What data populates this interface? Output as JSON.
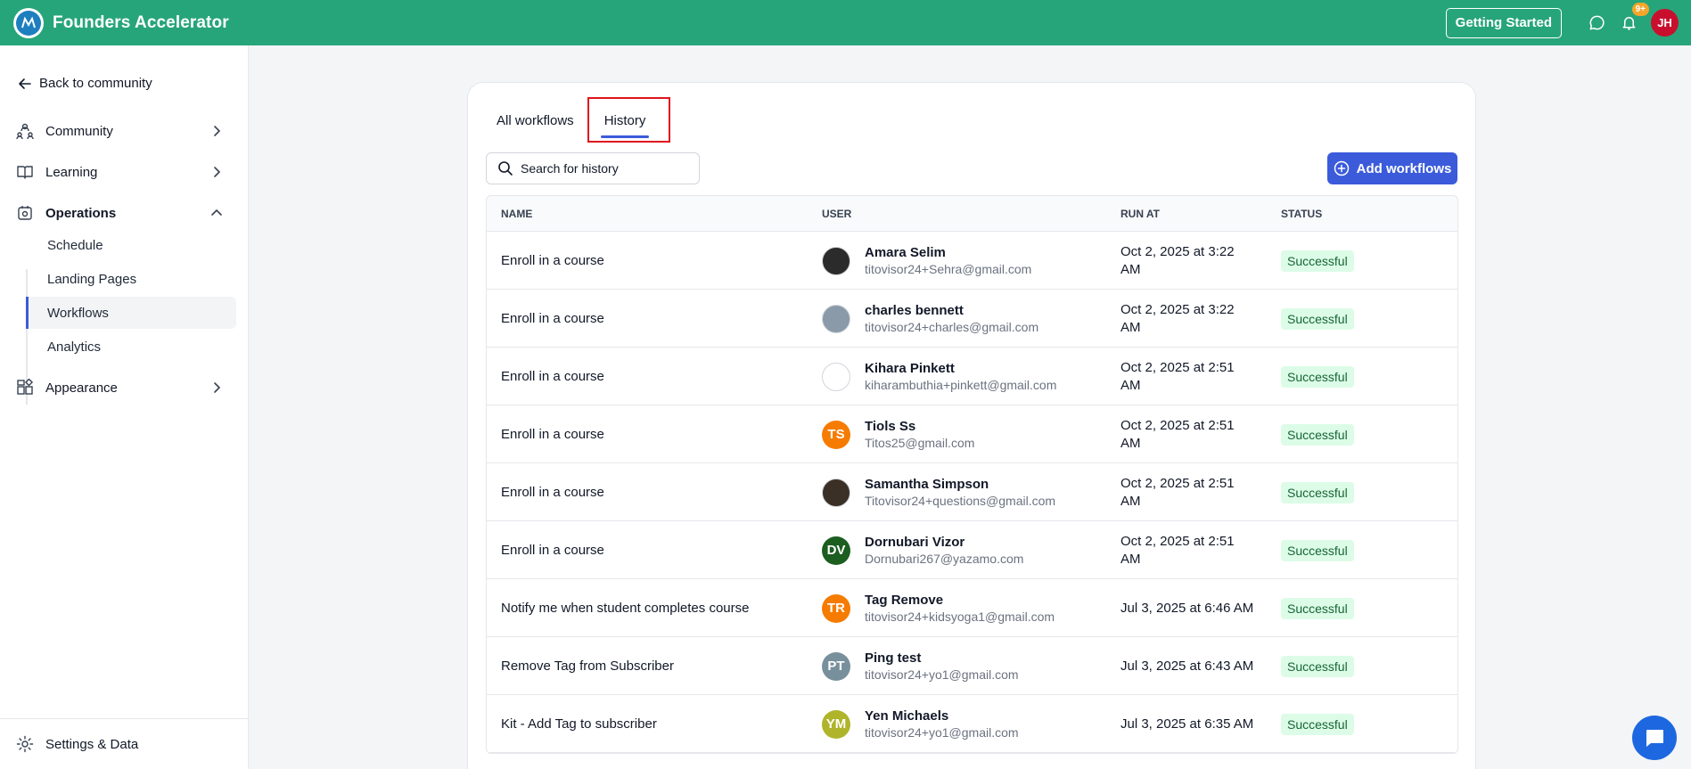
{
  "header": {
    "brand": "Founders Accelerator",
    "getting_started": "Getting Started",
    "notification_count": "9+",
    "user_initials": "JH",
    "colors": {
      "bar": "#27a57a",
      "avatar": "#c8102e"
    }
  },
  "sidebar": {
    "back_label": "Back to community",
    "items": [
      {
        "label": "Community",
        "icon": "community-icon"
      },
      {
        "label": "Learning",
        "icon": "book-icon"
      },
      {
        "label": "Operations",
        "icon": "operations-icon"
      },
      {
        "label": "Appearance",
        "icon": "appearance-icon"
      }
    ],
    "sub_items": [
      {
        "label": "Schedule"
      },
      {
        "label": "Landing Pages"
      },
      {
        "label": "Workflows"
      },
      {
        "label": "Analytics"
      }
    ],
    "footer_label": "Settings & Data"
  },
  "main": {
    "tabs": [
      {
        "label": "All workflows"
      },
      {
        "label": "History"
      }
    ],
    "search_placeholder": "Search for history",
    "add_button": "Add workflows",
    "table": {
      "headers": [
        "NAME",
        "USER",
        "RUN AT",
        "STATUS"
      ],
      "rows": [
        {
          "name": "Enroll in a course",
          "user": "Amara Selim",
          "email": "titovisor24+Sehra@gmail.com",
          "run_at": "Oct 2, 2025 at 3:22 AM",
          "status": "Successful",
          "initials": "",
          "avatar_color": "#2b2b2b"
        },
        {
          "name": "Enroll in a course",
          "user": "charles bennett",
          "email": "titovisor24+charles@gmail.com",
          "run_at": "Oct 2, 2025 at 3:22 AM",
          "status": "Successful",
          "initials": "",
          "avatar_color": "#8a9aa8"
        },
        {
          "name": "Enroll in a course",
          "user": "Kihara Pinkett",
          "email": "kiharambuthia+pinkett@gmail.com",
          "run_at": "Oct 2, 2025 at 2:51 AM",
          "status": "Successful",
          "initials": "",
          "avatar_color": "#ffffff"
        },
        {
          "name": "Enroll in a course",
          "user": "Tiols Ss",
          "email": "Titos25@gmail.com",
          "run_at": "Oct 2, 2025 at 2:51 AM",
          "status": "Successful",
          "initials": "TS",
          "avatar_color": "#f57c00"
        },
        {
          "name": "Enroll in a course",
          "user": "Samantha Simpson",
          "email": "Titovisor24+questions@gmail.com",
          "run_at": "Oct 2, 2025 at 2:51 AM",
          "status": "Successful",
          "initials": "",
          "avatar_color": "#3b3026"
        },
        {
          "name": "Enroll in a course",
          "user": "Dornubari Vizor",
          "email": "Dornubari267@yazamo.com",
          "run_at": "Oct 2, 2025 at 2:51 AM",
          "status": "Successful",
          "initials": "DV",
          "avatar_color": "#1b5e20"
        },
        {
          "name": "Notify me when student completes course",
          "user": "Tag Remove",
          "email": "titovisor24+kidsyoga1@gmail.com",
          "run_at": "Jul 3, 2025 at 6:46 AM",
          "status": "Successful",
          "initials": "TR",
          "avatar_color": "#f57c00"
        },
        {
          "name": "Remove Tag from Subscriber",
          "user": "Ping test",
          "email": "titovisor24+yo1@gmail.com",
          "run_at": "Jul 3, 2025 at 6:43 AM",
          "status": "Successful",
          "initials": "PT",
          "avatar_color": "#78909c"
        },
        {
          "name": "Kit - Add Tag to subscriber",
          "user": "Yen Michaels",
          "email": "titovisor24+yo1@gmail.com",
          "run_at": "Jul 3, 2025 at 6:35 AM",
          "status": "Successful",
          "initials": "YM",
          "avatar_color": "#afb42b"
        }
      ]
    }
  }
}
